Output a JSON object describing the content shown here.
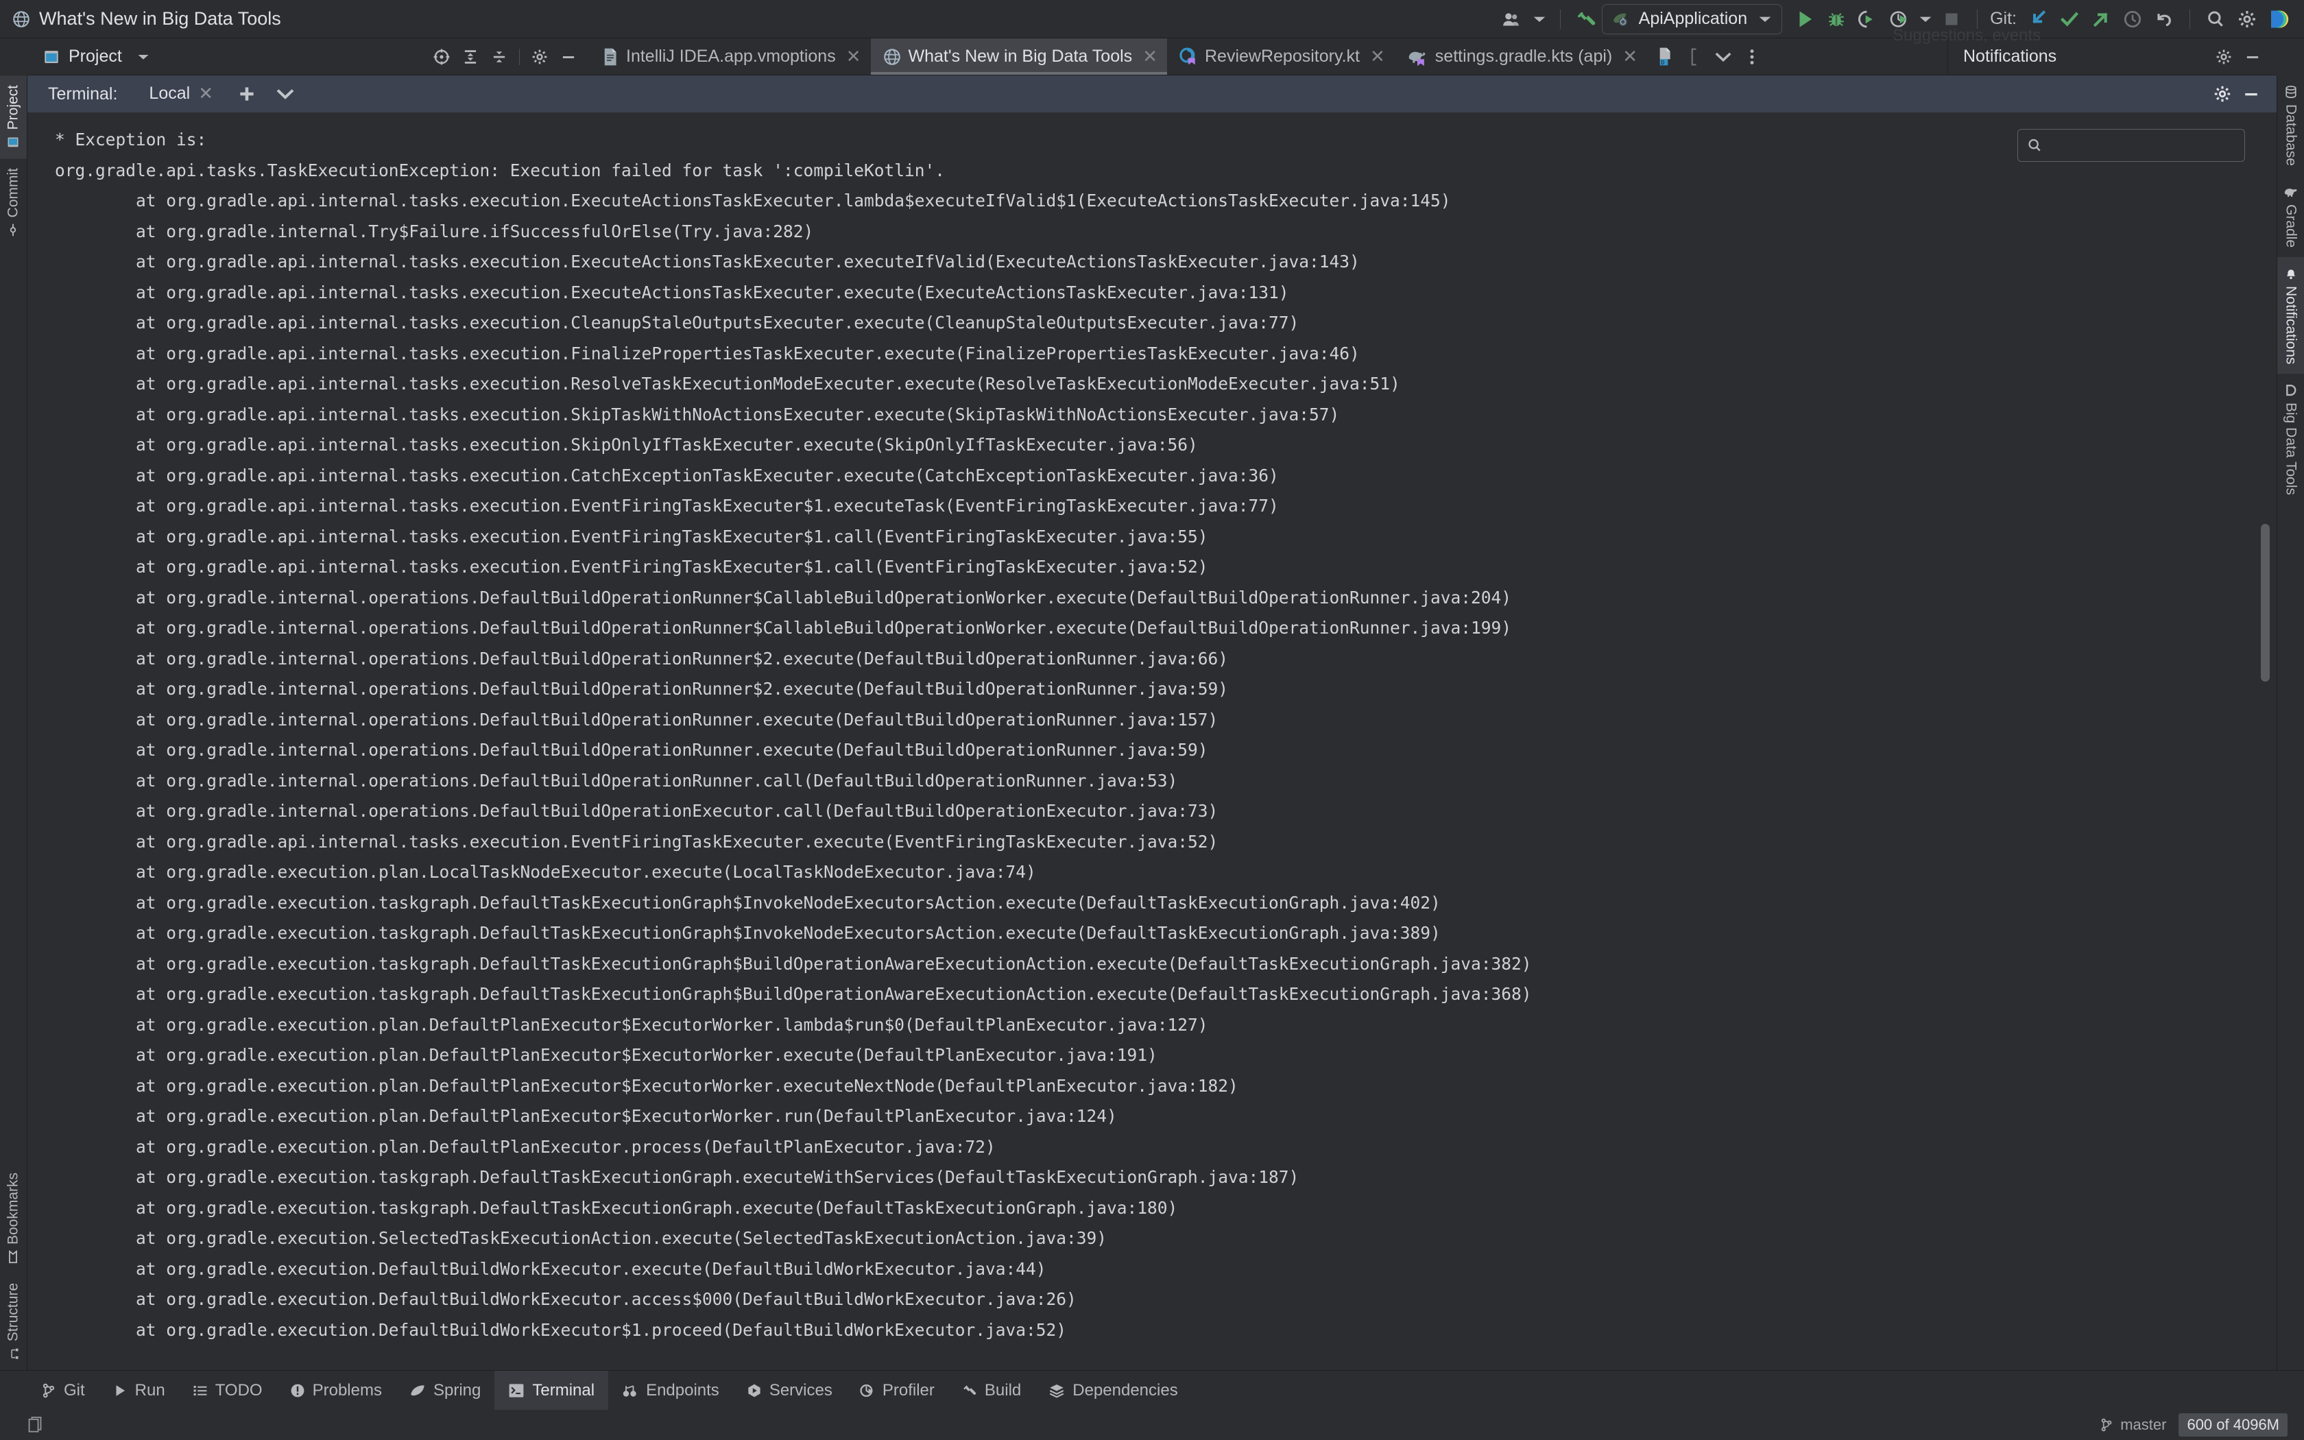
{
  "window": {
    "title": "What's New in Big Data Tools",
    "title_icon": "globe-icon"
  },
  "main_toolbar": {
    "account_icon": "user-account-icon",
    "account_dropdown_icon": "chevron-down-icon",
    "build_icon": "hammer-build-icon",
    "run_config": {
      "icon": "spring-boot-icon",
      "name": "ApiApplication",
      "dropdown_icon": "chevron-down-icon"
    },
    "run_icon": "run-play-icon",
    "debug_icon": "debug-bug-icon",
    "run_with_coverage_icon": "run-coverage-icon",
    "profiler_icon": "run-profiler-icon",
    "profiler_dropdown_icon": "chevron-down-icon",
    "stop_icon": "stop-square-icon",
    "git_label": "Git:",
    "git_update_icon": "update-project-arrow-icon",
    "git_commit_icon": "commit-checkmark-icon",
    "git_push_icon": "push-arrow-icon",
    "git_history_icon": "history-clock-icon",
    "git_rollback_icon": "rollback-undo-icon",
    "search_icon": "search-magnifier-icon",
    "settings_icon": "settings-gear-icon",
    "ide_icon": "intellij-idea-logo-icon"
  },
  "project_toolwindow": {
    "icon": "project-window-icon",
    "title": "Project",
    "dropdown_icon": "chevron-down-icon",
    "actions": [
      {
        "name": "select-opened-file-icon",
        "label": ""
      },
      {
        "name": "expand-all-icon",
        "label": ""
      },
      {
        "name": "collapse-all-icon",
        "label": ""
      },
      {
        "name": "settings-gear-icon",
        "label": ""
      },
      {
        "name": "hide-minimize-icon",
        "label": ""
      }
    ]
  },
  "editor_tabs": [
    {
      "label": "IntelliJ IDEA.app.vmoptions",
      "icon": "vmoptions-file-icon",
      "active": false,
      "close_icon": "close-x-icon"
    },
    {
      "label": "What's New in Big Data Tools",
      "icon": "globe-icon",
      "active": true,
      "close_icon": "close-x-icon"
    },
    {
      "label": "ReviewRepository.kt",
      "icon": "kotlin-class-icon",
      "active": false,
      "close_icon": "close-x-icon"
    },
    {
      "label": "settings.gradle.kts (api)",
      "icon": "gradle-elephant-icon",
      "active": false,
      "close_icon": "close-x-icon"
    }
  ],
  "editor_tabs_extra": {
    "diff_icon": "diff-file-icon",
    "list_tabs_icon": "chevron-down-icon",
    "more_icon": "more-vertical-dots-icon"
  },
  "notifications_panel": {
    "title": "Notifications",
    "settings_icon": "settings-gear-icon",
    "hide_icon": "hide-minimize-icon",
    "ghost_text": "Suggestions, events"
  },
  "left_stripe": [
    {
      "label": "Project",
      "icon": "project-window-icon",
      "active": true
    },
    {
      "label": "Commit",
      "icon": "commit-branch-icon",
      "active": false
    },
    {
      "label": "Bookmarks",
      "icon": "bookmarks-icon",
      "active": false
    },
    {
      "label": "Structure",
      "icon": "structure-icon",
      "active": false
    }
  ],
  "right_stripe": [
    {
      "label": "Database",
      "icon": "database-icon",
      "active": false
    },
    {
      "label": "Gradle",
      "icon": "gradle-elephant-icon",
      "active": false
    },
    {
      "label": "Notifications",
      "icon": "notifications-bell-icon",
      "active": true
    },
    {
      "label": "Big Data Tools",
      "icon": "big-data-tools-icon",
      "active": false
    }
  ],
  "terminal": {
    "label": "Terminal:",
    "tab_name": "Local",
    "tab_close_icon": "close-x-icon",
    "new_tab_icon": "plus-add-icon",
    "tab_list_icon": "chevron-down-icon",
    "settings_icon": "settings-gear-icon",
    "hide_icon": "hide-minimize-icon",
    "search": {
      "icon": "search-magnifier-icon",
      "value": "",
      "placeholder": ""
    },
    "output": "* Exception is:\norg.gradle.api.tasks.TaskExecutionException: Execution failed for task ':compileKotlin'.\n        at org.gradle.api.internal.tasks.execution.ExecuteActionsTaskExecuter.lambda$executeIfValid$1(ExecuteActionsTaskExecuter.java:145)\n        at org.gradle.internal.Try$Failure.ifSuccessfulOrElse(Try.java:282)\n        at org.gradle.api.internal.tasks.execution.ExecuteActionsTaskExecuter.executeIfValid(ExecuteActionsTaskExecuter.java:143)\n        at org.gradle.api.internal.tasks.execution.ExecuteActionsTaskExecuter.execute(ExecuteActionsTaskExecuter.java:131)\n        at org.gradle.api.internal.tasks.execution.CleanupStaleOutputsExecuter.execute(CleanupStaleOutputsExecuter.java:77)\n        at org.gradle.api.internal.tasks.execution.FinalizePropertiesTaskExecuter.execute(FinalizePropertiesTaskExecuter.java:46)\n        at org.gradle.api.internal.tasks.execution.ResolveTaskExecutionModeExecuter.execute(ResolveTaskExecutionModeExecuter.java:51)\n        at org.gradle.api.internal.tasks.execution.SkipTaskWithNoActionsExecuter.execute(SkipTaskWithNoActionsExecuter.java:57)\n        at org.gradle.api.internal.tasks.execution.SkipOnlyIfTaskExecuter.execute(SkipOnlyIfTaskExecuter.java:56)\n        at org.gradle.api.internal.tasks.execution.CatchExceptionTaskExecuter.execute(CatchExceptionTaskExecuter.java:36)\n        at org.gradle.api.internal.tasks.execution.EventFiringTaskExecuter$1.executeTask(EventFiringTaskExecuter.java:77)\n        at org.gradle.api.internal.tasks.execution.EventFiringTaskExecuter$1.call(EventFiringTaskExecuter.java:55)\n        at org.gradle.api.internal.tasks.execution.EventFiringTaskExecuter$1.call(EventFiringTaskExecuter.java:52)\n        at org.gradle.internal.operations.DefaultBuildOperationRunner$CallableBuildOperationWorker.execute(DefaultBuildOperationRunner.java:204)\n        at org.gradle.internal.operations.DefaultBuildOperationRunner$CallableBuildOperationWorker.execute(DefaultBuildOperationRunner.java:199)\n        at org.gradle.internal.operations.DefaultBuildOperationRunner$2.execute(DefaultBuildOperationRunner.java:66)\n        at org.gradle.internal.operations.DefaultBuildOperationRunner$2.execute(DefaultBuildOperationRunner.java:59)\n        at org.gradle.internal.operations.DefaultBuildOperationRunner.execute(DefaultBuildOperationRunner.java:157)\n        at org.gradle.internal.operations.DefaultBuildOperationRunner.execute(DefaultBuildOperationRunner.java:59)\n        at org.gradle.internal.operations.DefaultBuildOperationRunner.call(DefaultBuildOperationRunner.java:53)\n        at org.gradle.internal.operations.DefaultBuildOperationExecutor.call(DefaultBuildOperationExecutor.java:73)\n        at org.gradle.api.internal.tasks.execution.EventFiringTaskExecuter.execute(EventFiringTaskExecuter.java:52)\n        at org.gradle.execution.plan.LocalTaskNodeExecutor.execute(LocalTaskNodeExecutor.java:74)\n        at org.gradle.execution.taskgraph.DefaultTaskExecutionGraph$InvokeNodeExecutorsAction.execute(DefaultTaskExecutionGraph.java:402)\n        at org.gradle.execution.taskgraph.DefaultTaskExecutionGraph$InvokeNodeExecutorsAction.execute(DefaultTaskExecutionGraph.java:389)\n        at org.gradle.execution.taskgraph.DefaultTaskExecutionGraph$BuildOperationAwareExecutionAction.execute(DefaultTaskExecutionGraph.java:382)\n        at org.gradle.execution.taskgraph.DefaultTaskExecutionGraph$BuildOperationAwareExecutionAction.execute(DefaultTaskExecutionGraph.java:368)\n        at org.gradle.execution.plan.DefaultPlanExecutor$ExecutorWorker.lambda$run$0(DefaultPlanExecutor.java:127)\n        at org.gradle.execution.plan.DefaultPlanExecutor$ExecutorWorker.execute(DefaultPlanExecutor.java:191)\n        at org.gradle.execution.plan.DefaultPlanExecutor$ExecutorWorker.executeNextNode(DefaultPlanExecutor.java:182)\n        at org.gradle.execution.plan.DefaultPlanExecutor$ExecutorWorker.run(DefaultPlanExecutor.java:124)\n        at org.gradle.execution.plan.DefaultPlanExecutor.process(DefaultPlanExecutor.java:72)\n        at org.gradle.execution.taskgraph.DefaultTaskExecutionGraph.executeWithServices(DefaultTaskExecutionGraph.java:187)\n        at org.gradle.execution.taskgraph.DefaultTaskExecutionGraph.execute(DefaultTaskExecutionGraph.java:180)\n        at org.gradle.execution.SelectedTaskExecutionAction.execute(SelectedTaskExecutionAction.java:39)\n        at org.gradle.execution.DefaultBuildWorkExecutor.execute(DefaultBuildWorkExecutor.java:44)\n        at org.gradle.execution.DefaultBuildWorkExecutor.access$000(DefaultBuildWorkExecutor.java:26)\n        at org.gradle.execution.DefaultBuildWorkExecutor$1.proceed(DefaultBuildWorkExecutor.java:52)"
  },
  "bottom_tabs": [
    {
      "label": "Git",
      "icon": "git-branch-icon",
      "active": false
    },
    {
      "label": "Run",
      "icon": "run-play-icon",
      "active": false
    },
    {
      "label": "TODO",
      "icon": "todo-list-icon",
      "active": false
    },
    {
      "label": "Problems",
      "icon": "problems-warning-icon",
      "active": false
    },
    {
      "label": "Spring",
      "icon": "spring-leaf-icon",
      "active": false
    },
    {
      "label": "Terminal",
      "icon": "terminal-prompt-icon",
      "active": true
    },
    {
      "label": "Endpoints",
      "icon": "endpoints-icon",
      "active": false
    },
    {
      "label": "Services",
      "icon": "services-play-icon",
      "active": false
    },
    {
      "label": "Profiler",
      "icon": "profiler-icon",
      "active": false
    },
    {
      "label": "Build",
      "icon": "hammer-build-icon",
      "active": false
    },
    {
      "label": "Dependencies",
      "icon": "dependencies-layers-icon",
      "active": false
    }
  ],
  "status_bar": {
    "branch_icon": "git-branch-icon",
    "branch": "master",
    "memory": "600 of 4096M",
    "copy_icon": "copy-document-icon"
  },
  "colors": {
    "background": "#2b2d30",
    "terminal_bg": "#2b2d30",
    "terminal_header": "#3c4250",
    "accent_blue": "#4a88c7",
    "green": "#59a869",
    "text": "#dfe1e5"
  }
}
